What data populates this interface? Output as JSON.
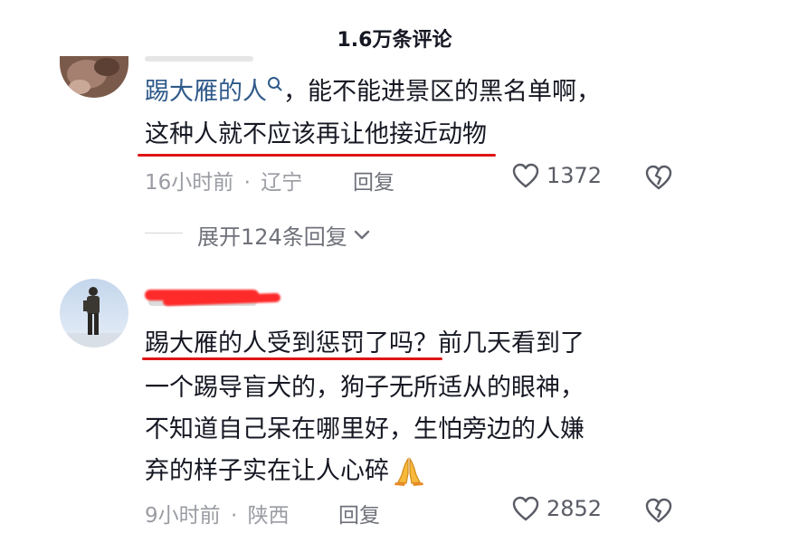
{
  "header": {
    "title": "1.6万条评论"
  },
  "comments": [
    {
      "username": "踢大雁的人",
      "text_rest_line1": "，能不能进景区的黑名单啊，",
      "text_line2": "这种人就不应该再让他接近动物",
      "time": "16小时前",
      "region": "辽宁",
      "reply_label": "回复",
      "likes": "1372",
      "expand_label": "展开124条回复"
    },
    {
      "text_line1": "踢大雁的人受到惩罚了吗？前几天看到了",
      "text_line2": "一个踢导盲犬的，狗子无所适从的眼神，",
      "text_line3": "不知道自己呆在哪里好，生怕旁边的人嫌",
      "text_line4": "弃的样子实在让人心碎",
      "emoji": "🙏",
      "time": "9小时前",
      "region": "陕西",
      "reply_label": "回复",
      "likes": "2852"
    }
  ],
  "meta_separator": "·",
  "colors": {
    "annotation": "#e01515",
    "link": "#2f5a8a"
  },
  "icons": [
    "search-icon",
    "heart-icon",
    "dislike-heart-icon",
    "chevron-down-icon",
    "praying-hands-emoji"
  ]
}
